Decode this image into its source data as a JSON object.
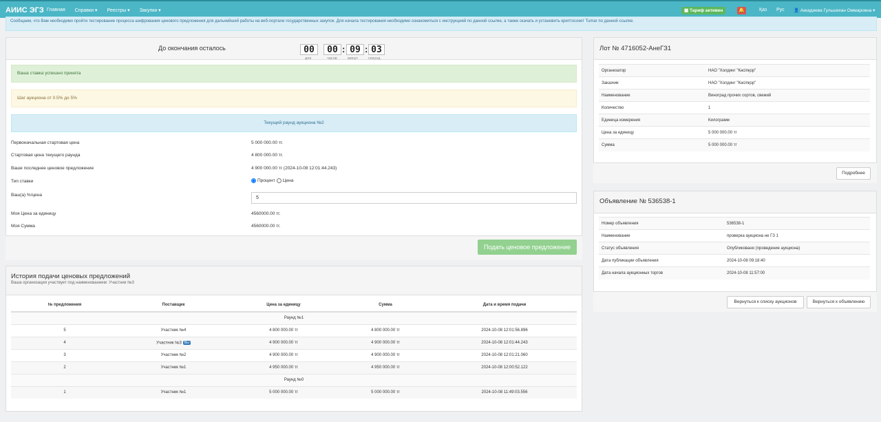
{
  "header": {
    "brand": "АИИС ЭГЗ",
    "nav": [
      "Главная",
      "Справки ▾",
      "Реестры ▾",
      "Закупки ▾"
    ],
    "tariff": "Тариф активен",
    "bell": "🔔",
    "lang_kz": "Қаз",
    "lang_ru": "Рус",
    "user": "Аккадиева Гульшехан Оммаровна"
  },
  "notice": "Сообщаем, что Вам необходимо пройти тестирование процесса шифрования ценового предложения для дальнейшей работы на веб-портале государственных закупок. Для начала тестирования необходимо ознакомиться с инструкцией по данной ссылке, а также скачать и установить криптосокет Tumar по данной ссылке.",
  "timer": {
    "title": "До окончания осталось",
    "days": "00",
    "hours": "00",
    "minutes": "09",
    "seconds": "03",
    "days_label": "дня",
    "hours_label": "часов",
    "minutes_label": "минут",
    "seconds_label": "секунд"
  },
  "alerts": {
    "success": "Ваша ставка успешно принята",
    "warning": "Шаг аукциона от 0.5% до 5%",
    "info": "Текущий раунд аукциона №2"
  },
  "details": [
    {
      "label": "Первоначальная стартовая цена",
      "value": "5 000 000.00 тг."
    },
    {
      "label": "Стартовая цена текущего раунда",
      "value": "4 800 000.00 тг."
    },
    {
      "label": "Ваше последнее ценовое предложение",
      "value": "4 900 000.00 тг (2024-10-08 12:01:44.243)"
    }
  ],
  "bet_type": {
    "label": "Тип ставки",
    "opt1": "Процент",
    "opt2": "Цена"
  },
  "your_price": {
    "label": "Ваш(а) %/цена",
    "value": "5"
  },
  "my_unit": {
    "label": "Моя Цена за единицу",
    "value": "4560000.00 тг."
  },
  "my_sum": {
    "label": "Моя Сумма",
    "value": "4560000.00 тг."
  },
  "submit_label": "Подать ценовое предложение",
  "history": {
    "title": "История подачи ценовых предложений",
    "subtitle": "Ваша организация участвует под наименованием: Участник №3",
    "columns": [
      "№ предложения",
      "Поставщик",
      "Цена за единицу",
      "Сумма",
      "Дата и время подачи"
    ],
    "round2": "Раунд №1",
    "round1": "Раунд №0",
    "rows": [
      {
        "n": "5",
        "supplier": "Участник №4",
        "price": "4 800 000.00 тг",
        "sum": "4 800 000.00 тг",
        "date": "2024-10-08 12:01:56.896"
      },
      {
        "n": "4",
        "supplier": "Участник №3",
        "price": "4 900 000.00 тг",
        "sum": "4 900 000.00 тг",
        "date": "2024-10-08 12:01:44.243"
      },
      {
        "n": "3",
        "supplier": "Участник №2",
        "price": "4 900 000.00 тг",
        "sum": "4 900 000.00 тг",
        "date": "2024-10-08 12:01:21.060"
      },
      {
        "n": "2",
        "supplier": "Участник №1",
        "price": "4 950 000.00 тг",
        "sum": "4 950 000.00 тг",
        "date": "2024-10-08 12:00:52.122"
      },
      {
        "n": "1",
        "supplier": "Участник №1",
        "price": "5 000 000.00 тг",
        "sum": "5 000 000.00 тг",
        "date": "2024-10-08 11:49:03.556"
      }
    ],
    "you_badge": "Вы"
  },
  "lot": {
    "title": "Лот № 4716052-АнеГЗ1",
    "rows": [
      {
        "label": "Организатор",
        "value": "НАО \"Холдинг \"Кәсіпқор\""
      },
      {
        "label": "Заказчик",
        "value": "НАО \"Холдинг \"Кәсіпқор\""
      },
      {
        "label": "Наименование",
        "value": "Виноград прочих сортов, свежий"
      },
      {
        "label": "Количество",
        "value": "1"
      },
      {
        "label": "Единица измерения",
        "value": "Килограмм"
      },
      {
        "label": "Цена за единицу",
        "value": "5 000 000.00 тг"
      },
      {
        "label": "Сумма",
        "value": "5 000 000.00 тг"
      }
    ],
    "more_button": "Подробнее"
  },
  "announcement": {
    "title": "Объявление № 536538-1",
    "rows": [
      {
        "label": "Номер объявления",
        "value": "536538-1"
      },
      {
        "label": "Наименование",
        "value": "проверка аукциона не ГЗ 1"
      },
      {
        "label": "Статус объявления",
        "value": "Опубликовано (проведение аукциона)"
      },
      {
        "label": "Дата публикации объявления",
        "value": "2024-10-08 09:18:40"
      },
      {
        "label": "Дата начала аукционных торгов",
        "value": "2024-10-08 11:57:00"
      }
    ],
    "back_list": "Вернуться к списку аукционов",
    "back_ann": "Вернуться к объявлению"
  },
  "colors": {
    "topbar": "#4bb6c6",
    "success": "#dff0d8",
    "warning": "#fcf8e3",
    "info": "#d9edf7",
    "submit": "#92d18f"
  }
}
